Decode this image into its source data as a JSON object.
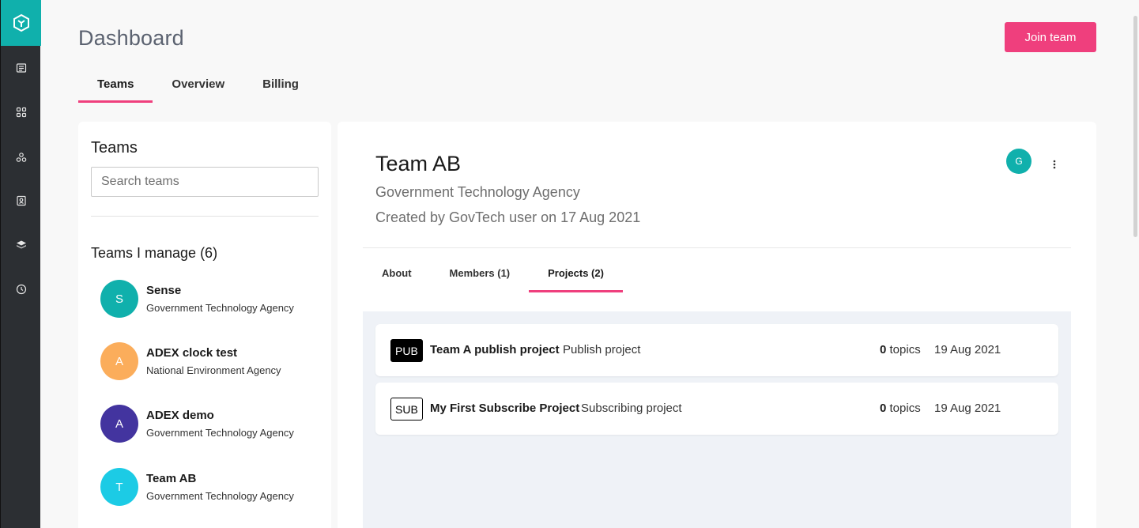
{
  "sidebar": {
    "icons": [
      "logo-icon",
      "news-icon",
      "grid-icon",
      "network-icon",
      "contact-card-icon",
      "layers-icon",
      "clock-icon"
    ]
  },
  "header": {
    "title": "Dashboard",
    "join_button": "Join team",
    "tabs": [
      "Teams",
      "Overview",
      "Billing"
    ],
    "active_tab": "Teams"
  },
  "teams_panel": {
    "title": "Teams",
    "search_placeholder": "Search teams",
    "manage_title": "Teams I manage (6)",
    "teams": [
      {
        "initial": "S",
        "name": "Sense",
        "agency": "Government Technology Agency",
        "color": "#10b0ac"
      },
      {
        "initial": "A",
        "name": "ADEX clock test",
        "agency": "National Environment Agency",
        "color": "#fbad5b"
      },
      {
        "initial": "A",
        "name": "ADEX demo",
        "agency": "Government Technology Agency",
        "color": "#43349f"
      },
      {
        "initial": "T",
        "name": "Team AB",
        "agency": "Government Technology Agency",
        "color": "#1ccbe5"
      }
    ]
  },
  "team_detail": {
    "title": "Team AB",
    "agency": "Government Technology Agency",
    "created": "Created by GovTech user on 17 Aug 2021",
    "member_initial": "G",
    "tabs": [
      "About",
      "Members (1)",
      "Projects (2)"
    ],
    "active_tab": "Projects (2)",
    "projects": [
      {
        "badge": "PUB",
        "name": "Team A publish project",
        "description": "Publish project",
        "topics_count": "0",
        "topics_label": "topics",
        "date": "19 Aug 2021"
      },
      {
        "badge": "SUB",
        "name": "My First Subscribe Project",
        "description": "Subscribing project",
        "topics_count": "0",
        "topics_label": "topics",
        "date": "19 Aug 2021"
      }
    ]
  },
  "colors": {
    "accent": "#ef3f7d",
    "brand": "#10b0ac",
    "sidebar": "#2c2f33"
  }
}
